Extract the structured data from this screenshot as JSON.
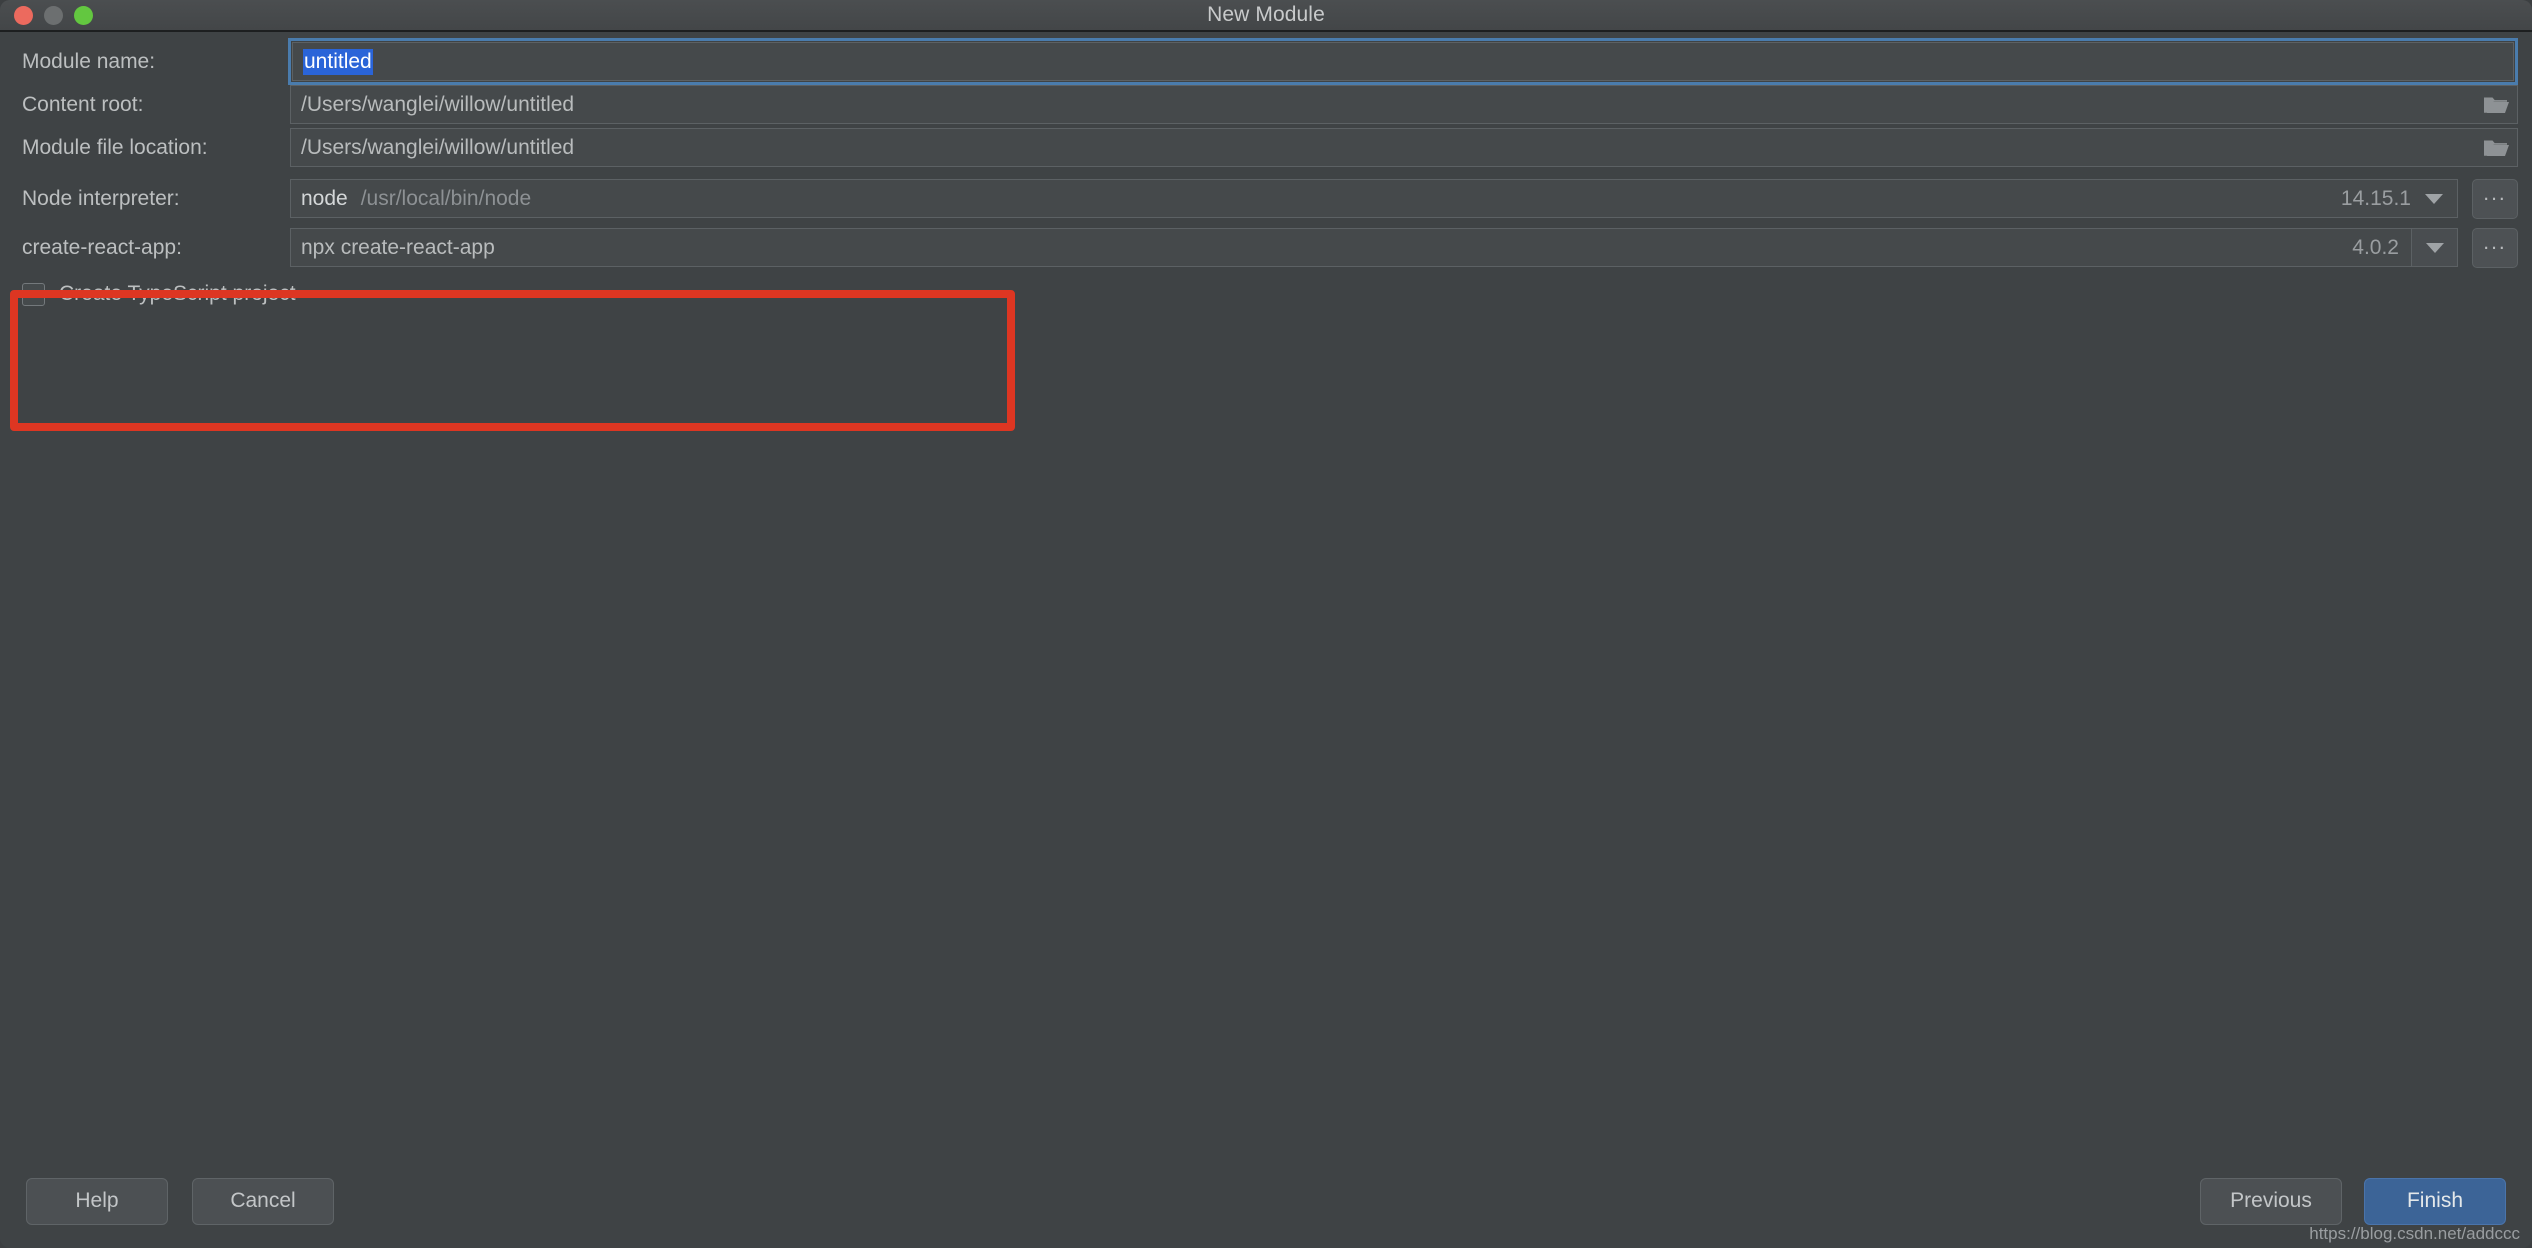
{
  "window": {
    "title": "New Module",
    "traffic_lights": [
      {
        "name": "close",
        "color": "#ec6a5e"
      },
      {
        "name": "minimize",
        "color": "#6c6f70"
      },
      {
        "name": "zoom",
        "color": "#63c740"
      }
    ]
  },
  "form": {
    "module_name": {
      "label": "Module name:",
      "value": "untitled",
      "selected": true
    },
    "content_root": {
      "label": "Content root:",
      "value": "/Users/wanglei/willow/untitled",
      "browse_icon": "folder-icon"
    },
    "module_file_location": {
      "label": "Module file location:",
      "value": "/Users/wanglei/willow/untitled",
      "browse_icon": "folder-icon"
    },
    "node_interpreter": {
      "label": "Node interpreter:",
      "name": "node",
      "path": "/usr/local/bin/node",
      "version": "14.15.1",
      "dropdown_icon": "chevron-down-icon",
      "browse_label": "..."
    },
    "create_react_app": {
      "label": "create-react-app:",
      "value": "npx create-react-app",
      "version": "4.0.2",
      "dropdown_icon": "chevron-down-icon",
      "browse_label": "..."
    },
    "typescript": {
      "label": "Create TypeScript project",
      "checked": false
    }
  },
  "annotation": {
    "shape": "rectangle",
    "color": "#dd3622",
    "surrounds": [
      "Node interpreter:",
      "create-react-app:"
    ]
  },
  "footer": {
    "help": "Help",
    "cancel": "Cancel",
    "previous": "Previous",
    "finish": "Finish",
    "finish_accent": "#3c6497"
  },
  "watermark": "https://blog.csdn.net/addccc"
}
